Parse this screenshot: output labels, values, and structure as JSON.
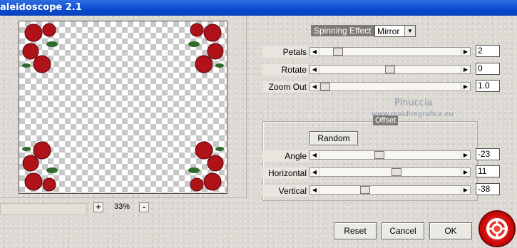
{
  "window": {
    "title": "aleidoscope 2.1"
  },
  "preview": {
    "zoom_minus": "-",
    "zoom_plus": "+",
    "zoom_value": "33%"
  },
  "spinning": {
    "label": "Spinning Effect",
    "mode_value": "Mirror"
  },
  "controls": [
    {
      "label": "Petals",
      "value": "2",
      "position": 0.1
    },
    {
      "label": "Rotate",
      "value": "0",
      "position": 0.5
    },
    {
      "label": "Zoom Out",
      "value": "1.0",
      "position": 0.0
    }
  ],
  "watermark": {
    "line1": "Pinuccia",
    "line2": "www.maidiregrafica.eu"
  },
  "offset": {
    "label": "Offset",
    "random_label": "Random",
    "controls": [
      {
        "label": "Angle",
        "value": "-23",
        "position": 0.42
      },
      {
        "label": "Horizontal",
        "value": "11",
        "position": 0.55
      },
      {
        "label": "Vertical",
        "value": "-38",
        "position": 0.31
      }
    ]
  },
  "buttons": {
    "reset": "Reset",
    "cancel": "Cancel",
    "ok": "OK"
  },
  "icons": {
    "help": "lifebuoy-help-icon",
    "zoom_out": "minus-icon",
    "zoom_in": "plus-icon"
  }
}
